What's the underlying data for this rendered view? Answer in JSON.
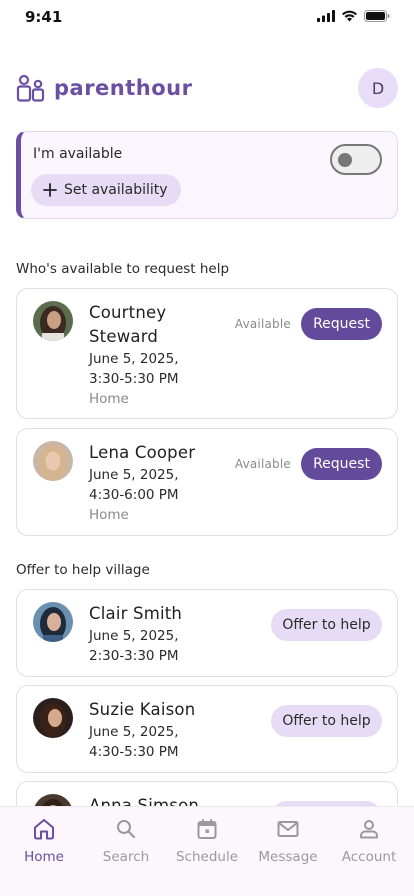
{
  "status_bar": {
    "time": "9:41"
  },
  "header": {
    "brand_name": "parenthour",
    "avatar_initial": "D"
  },
  "availability": {
    "label": "I'm available",
    "set_button": "Set availability",
    "toggle_on": false
  },
  "sections": {
    "request_title": "Who's available to request help",
    "offer_title": "Offer to help village"
  },
  "available_people": [
    {
      "name": "Courtney Steward",
      "date": "June 5, 2025,",
      "time": "3:30-5:30 PM",
      "location": "Home",
      "status": "Available",
      "action": "Request"
    },
    {
      "name": "Lena Cooper",
      "date": "June 5, 2025,",
      "time": "4:30-6:00 PM",
      "location": "Home",
      "status": "Available",
      "action": "Request"
    }
  ],
  "offer_people": [
    {
      "name": "Clair Smith",
      "date": "June 5, 2025,",
      "time": "2:30-3:30 PM",
      "action": "Offer to help"
    },
    {
      "name": "Suzie Kaison",
      "date": "June 5, 2025,",
      "time": "4:30-5:30 PM",
      "action": "Offer to help"
    },
    {
      "name": "Anna Simson"
    }
  ],
  "nav": {
    "items": [
      {
        "label": "Home",
        "icon": "home-icon",
        "active": true
      },
      {
        "label": "Search",
        "icon": "search-icon",
        "active": false
      },
      {
        "label": "Schedule",
        "icon": "calendar-icon",
        "active": false
      },
      {
        "label": "Message",
        "icon": "mail-icon",
        "active": false
      },
      {
        "label": "Account",
        "icon": "user-icon",
        "active": false
      }
    ]
  },
  "colors": {
    "brand": "#6a4fa3",
    "request_button": "#644a9a",
    "chip": "#e6dcf6",
    "card_highlight": "#fbf5fe"
  }
}
